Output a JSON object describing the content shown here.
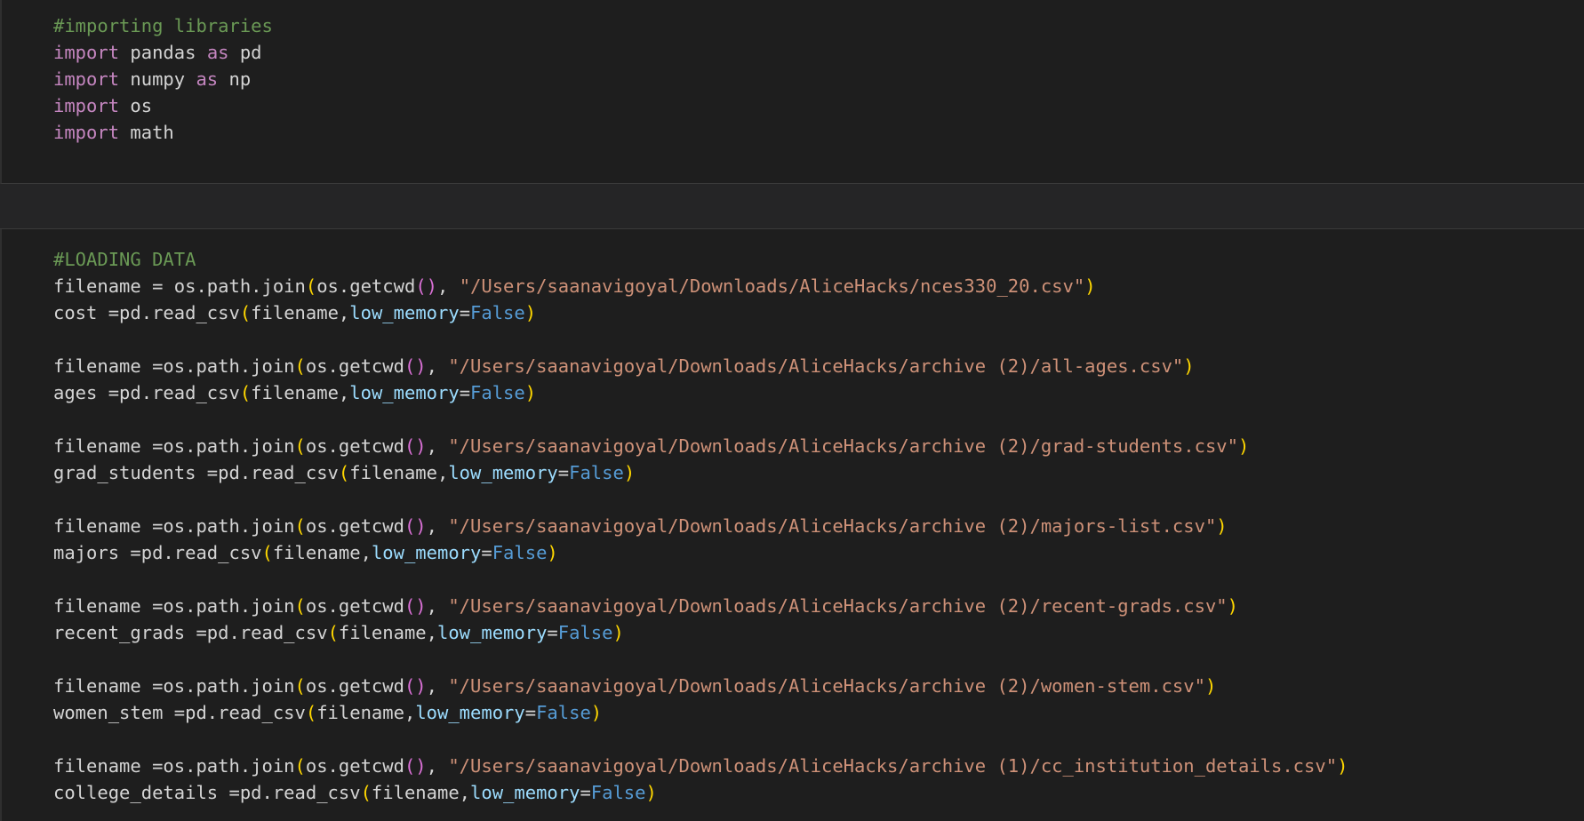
{
  "cells": [
    {
      "lines": [
        [
          [
            "comment",
            "#importing libraries"
          ]
        ],
        [
          [
            "kw",
            "import"
          ],
          [
            "plain",
            " pandas "
          ],
          [
            "kw",
            "as"
          ],
          [
            "plain",
            " pd"
          ]
        ],
        [
          [
            "kw",
            "import"
          ],
          [
            "plain",
            " numpy "
          ],
          [
            "kw",
            "as"
          ],
          [
            "plain",
            " np"
          ]
        ],
        [
          [
            "kw",
            "import"
          ],
          [
            "plain",
            " os"
          ]
        ],
        [
          [
            "kw",
            "import"
          ],
          [
            "plain",
            " math"
          ]
        ]
      ]
    },
    {
      "lines": [
        [
          [
            "comment",
            "#LOADING DATA"
          ]
        ],
        [
          [
            "plain",
            "filename = os.path.join"
          ],
          [
            "p1",
            "("
          ],
          [
            "plain",
            "os.getcwd"
          ],
          [
            "p2",
            "()"
          ],
          [
            "plain",
            ", "
          ],
          [
            "str",
            "\"/Users/saanavigoyal/Downloads/AliceHacks/nces330_20.csv\""
          ],
          [
            "p1",
            ")"
          ]
        ],
        [
          [
            "plain",
            "cost =pd.read_csv"
          ],
          [
            "p1",
            "("
          ],
          [
            "plain",
            "filename,"
          ],
          [
            "param",
            "low_memory"
          ],
          [
            "plain",
            "="
          ],
          [
            "const",
            "False"
          ],
          [
            "p1",
            ")"
          ]
        ],
        [],
        [
          [
            "plain",
            "filename =os.path.join"
          ],
          [
            "p1",
            "("
          ],
          [
            "plain",
            "os.getcwd"
          ],
          [
            "p2",
            "()"
          ],
          [
            "plain",
            ", "
          ],
          [
            "str",
            "\"/Users/saanavigoyal/Downloads/AliceHacks/archive (2)/all-ages.csv\""
          ],
          [
            "p1",
            ")"
          ]
        ],
        [
          [
            "plain",
            "ages =pd.read_csv"
          ],
          [
            "p1",
            "("
          ],
          [
            "plain",
            "filename,"
          ],
          [
            "param",
            "low_memory"
          ],
          [
            "plain",
            "="
          ],
          [
            "const",
            "False"
          ],
          [
            "p1",
            ")"
          ]
        ],
        [],
        [
          [
            "plain",
            "filename =os.path.join"
          ],
          [
            "p1",
            "("
          ],
          [
            "plain",
            "os.getcwd"
          ],
          [
            "p2",
            "()"
          ],
          [
            "plain",
            ", "
          ],
          [
            "str",
            "\"/Users/saanavigoyal/Downloads/AliceHacks/archive (2)/grad-students.csv\""
          ],
          [
            "p1",
            ")"
          ]
        ],
        [
          [
            "plain",
            "grad_students =pd.read_csv"
          ],
          [
            "p1",
            "("
          ],
          [
            "plain",
            "filename,"
          ],
          [
            "param",
            "low_memory"
          ],
          [
            "plain",
            "="
          ],
          [
            "const",
            "False"
          ],
          [
            "p1",
            ")"
          ]
        ],
        [],
        [
          [
            "plain",
            "filename =os.path.join"
          ],
          [
            "p1",
            "("
          ],
          [
            "plain",
            "os.getcwd"
          ],
          [
            "p2",
            "()"
          ],
          [
            "plain",
            ", "
          ],
          [
            "str",
            "\"/Users/saanavigoyal/Downloads/AliceHacks/archive (2)/majors-list.csv\""
          ],
          [
            "p1",
            ")"
          ]
        ],
        [
          [
            "plain",
            "majors =pd.read_csv"
          ],
          [
            "p1",
            "("
          ],
          [
            "plain",
            "filename,"
          ],
          [
            "param",
            "low_memory"
          ],
          [
            "plain",
            "="
          ],
          [
            "const",
            "False"
          ],
          [
            "p1",
            ")"
          ]
        ],
        [],
        [
          [
            "plain",
            "filename =os.path.join"
          ],
          [
            "p1",
            "("
          ],
          [
            "plain",
            "os.getcwd"
          ],
          [
            "p2",
            "()"
          ],
          [
            "plain",
            ", "
          ],
          [
            "str",
            "\"/Users/saanavigoyal/Downloads/AliceHacks/archive (2)/recent-grads.csv\""
          ],
          [
            "p1",
            ")"
          ]
        ],
        [
          [
            "plain",
            "recent_grads =pd.read_csv"
          ],
          [
            "p1",
            "("
          ],
          [
            "plain",
            "filename,"
          ],
          [
            "param",
            "low_memory"
          ],
          [
            "plain",
            "="
          ],
          [
            "const",
            "False"
          ],
          [
            "p1",
            ")"
          ]
        ],
        [],
        [
          [
            "plain",
            "filename =os.path.join"
          ],
          [
            "p1",
            "("
          ],
          [
            "plain",
            "os.getcwd"
          ],
          [
            "p2",
            "()"
          ],
          [
            "plain",
            ", "
          ],
          [
            "str",
            "\"/Users/saanavigoyal/Downloads/AliceHacks/archive (2)/women-stem.csv\""
          ],
          [
            "p1",
            ")"
          ]
        ],
        [
          [
            "plain",
            "women_stem =pd.read_csv"
          ],
          [
            "p1",
            "("
          ],
          [
            "plain",
            "filename,"
          ],
          [
            "param",
            "low_memory"
          ],
          [
            "plain",
            "="
          ],
          [
            "const",
            "False"
          ],
          [
            "p1",
            ")"
          ]
        ],
        [],
        [
          [
            "plain",
            "filename =os.path.join"
          ],
          [
            "p1",
            "("
          ],
          [
            "plain",
            "os.getcwd"
          ],
          [
            "p2",
            "()"
          ],
          [
            "plain",
            ", "
          ],
          [
            "str",
            "\"/Users/saanavigoyal/Downloads/AliceHacks/archive (1)/cc_institution_details.csv\""
          ],
          [
            "p1",
            ")"
          ]
        ],
        [
          [
            "plain",
            "college_details =pd.read_csv"
          ],
          [
            "p1",
            "("
          ],
          [
            "plain",
            "filename,"
          ],
          [
            "param",
            "low_memory"
          ],
          [
            "plain",
            "="
          ],
          [
            "const",
            "False"
          ],
          [
            "p1",
            ")"
          ]
        ]
      ]
    }
  ]
}
